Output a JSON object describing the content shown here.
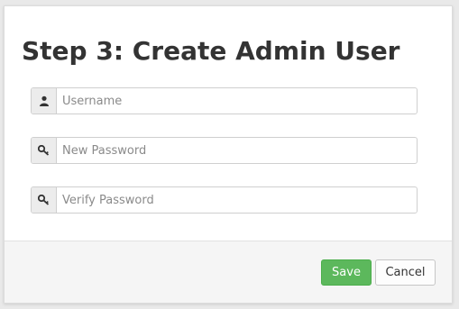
{
  "dialog": {
    "title": "Step 3: Create Admin User",
    "fields": [
      {
        "icon": "user-icon",
        "placeholder": "Username",
        "value": ""
      },
      {
        "icon": "key-icon",
        "placeholder": "New Password",
        "value": ""
      },
      {
        "icon": "key-icon",
        "placeholder": "Verify Password",
        "value": ""
      }
    ],
    "buttons": {
      "save_label": "Save",
      "cancel_label": "Cancel"
    },
    "colors": {
      "save_button": "#5cb85c",
      "title_text": "#333333"
    }
  }
}
